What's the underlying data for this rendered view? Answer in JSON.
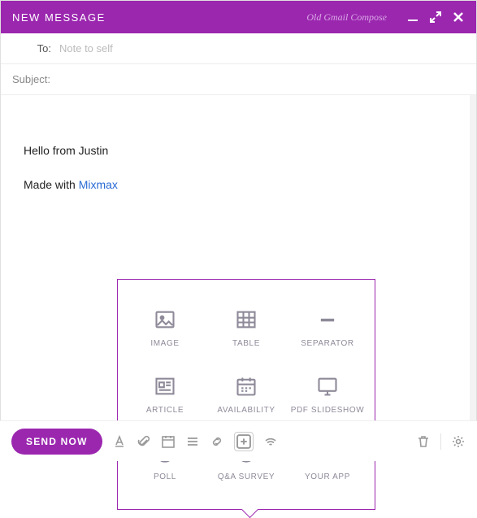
{
  "header": {
    "title": "NEW MESSAGE",
    "mode_label": "Old Gmail Compose"
  },
  "fields": {
    "to_label": "To:",
    "to_placeholder": "Note to self",
    "subject_label": "Subject:",
    "subject_value": ""
  },
  "body": {
    "line1": "Hello from Justin",
    "line2_prefix": "Made with ",
    "line2_link": "Mixmax"
  },
  "insert_menu": {
    "items": [
      {
        "label": "IMAGE",
        "icon": "image-icon"
      },
      {
        "label": "TABLE",
        "icon": "table-icon"
      },
      {
        "label": "SEPARATOR",
        "icon": "separator-icon"
      },
      {
        "label": "ARTICLE",
        "icon": "article-icon"
      },
      {
        "label": "AVAILABILITY",
        "icon": "availability-icon"
      },
      {
        "label": "PDF SLIDESHOW",
        "icon": "pdf-slideshow-icon"
      },
      {
        "label": "POLL",
        "icon": "poll-icon"
      },
      {
        "label": "Q&A SURVEY",
        "icon": "qa-survey-icon"
      },
      {
        "label": "YOUR APP",
        "icon": "your-app-icon"
      }
    ]
  },
  "footer": {
    "send_label": "SEND NOW"
  }
}
